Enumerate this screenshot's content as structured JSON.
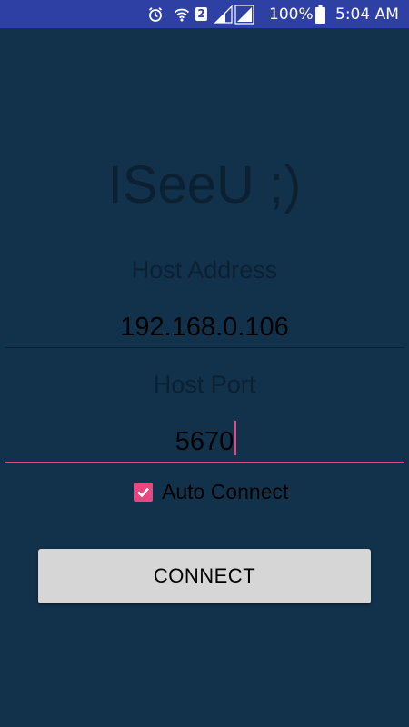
{
  "status_bar": {
    "network_badge": "2",
    "battery_percent": "100%",
    "time": "5:04 AM",
    "icons": [
      "alarm-icon",
      "wifi-icon",
      "sim-badge-icon",
      "signal-icon",
      "signal-icon",
      "battery-icon"
    ]
  },
  "app": {
    "title": "ISeeU ;)"
  },
  "host_address": {
    "label": "Host Address",
    "value": "192.168.0.106"
  },
  "host_port": {
    "label": "Host Port",
    "value": "5670"
  },
  "auto_connect": {
    "label": "Auto Connect",
    "checked": true
  },
  "connect_button": {
    "label": "CONNECT"
  },
  "colors": {
    "background": "#12324b",
    "status_bar": "#2f40a5",
    "accent": "#e8467f",
    "button": "#d6d6d6"
  }
}
